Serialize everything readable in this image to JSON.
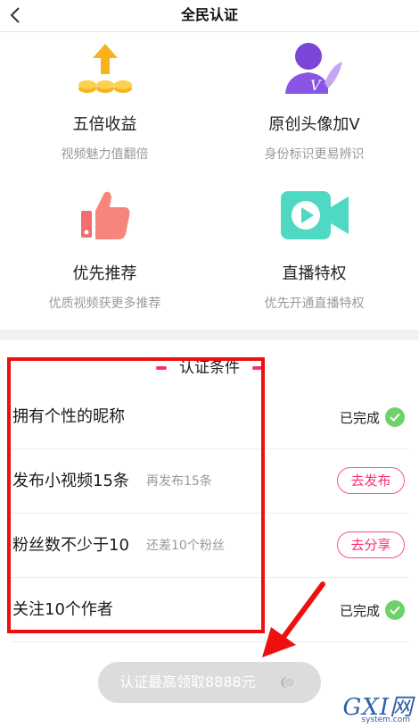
{
  "header": {
    "title": "全民认证",
    "back_icon": "chevron-left-icon"
  },
  "benefits": [
    {
      "icon": "arrow-up-coins-icon",
      "name": "五倍收益",
      "desc": "视频魅力值翻倍"
    },
    {
      "icon": "vip-avatar-icon",
      "name": "原创头像加V",
      "desc": "身份标识更易辨识"
    },
    {
      "icon": "thumbs-up-icon",
      "name": "优先推荐",
      "desc": "优质视频获更多推荐"
    },
    {
      "icon": "video-camera-icon",
      "name": "直播特权",
      "desc": "优先开通直播特权"
    }
  ],
  "conditions": {
    "title": "认证条件",
    "items": [
      {
        "label": "拥有个性的昵称",
        "hint": "",
        "status": "已完成"
      },
      {
        "label": "发布小视频15条",
        "hint": "再发布15条",
        "action": "去发布"
      },
      {
        "label": "粉丝数不少于10",
        "hint": "还差10个粉丝",
        "action": "去分享"
      },
      {
        "label": "关注10个作者",
        "hint": "",
        "status": "已完成"
      }
    ]
  },
  "cta": {
    "label": "认证最高领取8888元",
    "icon": "coin-icon"
  },
  "watermark": {
    "brand": "GXI网",
    "site": "system.com"
  },
  "colors": {
    "accent": "#ff2f6e",
    "done_green": "#6dd26a",
    "annotation_red": "#ee1010",
    "cta_disabled": "#dcdcdc"
  }
}
